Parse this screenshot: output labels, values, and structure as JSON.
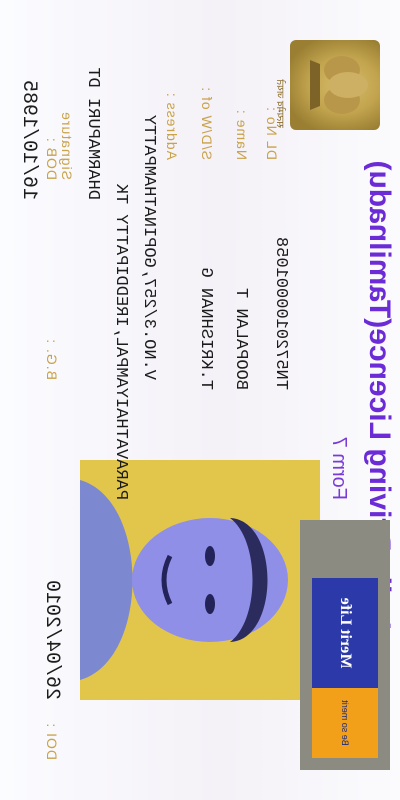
{
  "header": {
    "title": "India Driving Licence(Tamilnadu)",
    "form": "Form 7"
  },
  "fields": {
    "dob_label": "DOB :",
    "dob_value": "16/10/1985",
    "bg_label": "B.G. :",
    "doi_label": "DOI :",
    "doi_value": "26/04/2010",
    "dl_label": "DL No :",
    "dl_value": "TN5720100001058",
    "name_label": "Name :",
    "name_value": "BOOPALAN T",
    "sdw_label": "S/D/W of :",
    "sdw_value": "T.KRISHNAN G",
    "address_label": "Address :",
    "address_lines": [
      "V.NO.3/257,GOPINATHAMPATTY",
      "PARAVATHAIYAMPAL,IREDDIPATTY TK",
      "DHARMAPURI DT"
    ],
    "sign_label": "Signature"
  },
  "branding": {
    "emblem_caption": "सत्यमेव जयते",
    "logo_name": "Merit Life",
    "logo_tag": "Be so merit"
  },
  "colors": {
    "title": "#6b2bd6",
    "label": "#c9a24a",
    "photo_bg": "#e2c64c",
    "logo_blue": "#2b3aa8",
    "logo_orange": "#f2a01a"
  }
}
